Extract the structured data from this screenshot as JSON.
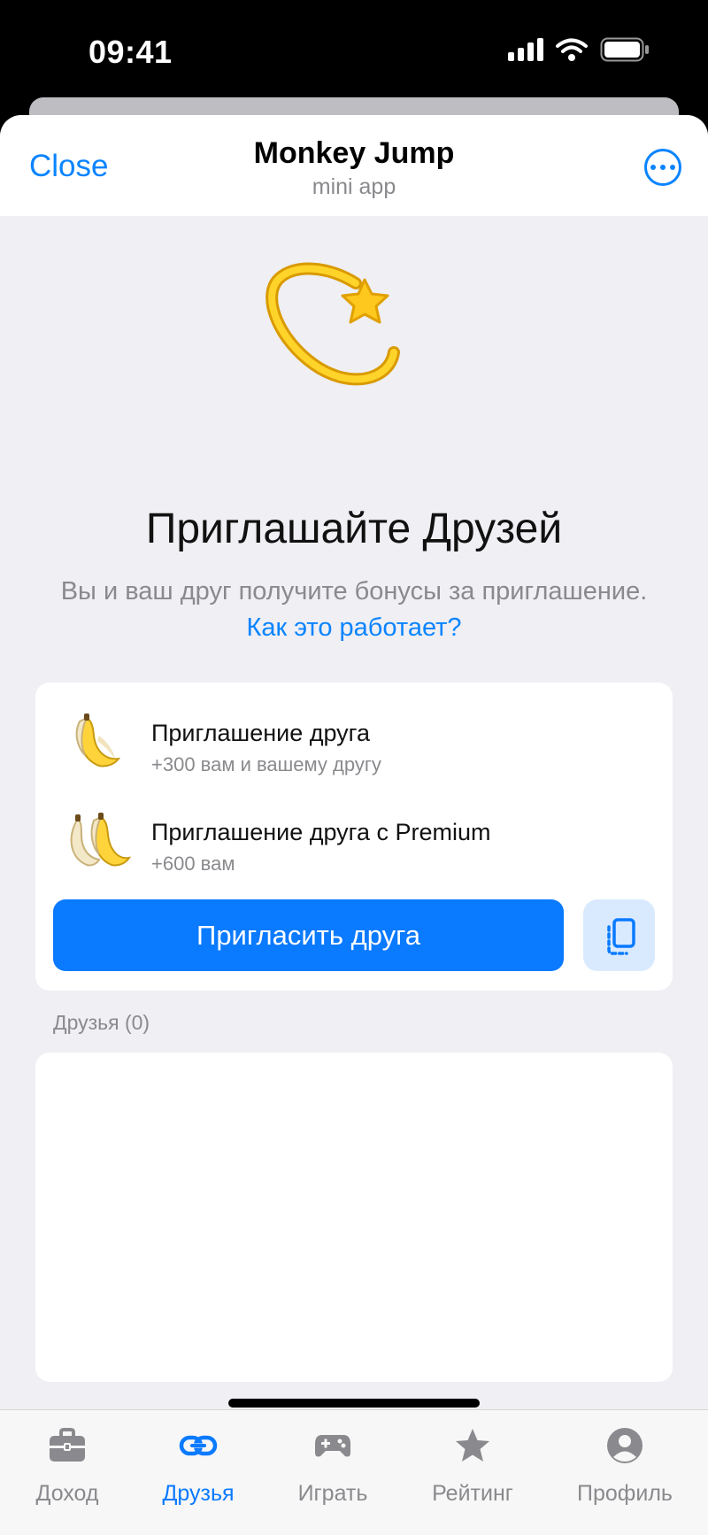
{
  "status_bar": {
    "time": "09:41"
  },
  "header": {
    "close_label": "Close",
    "title": "Monkey Jump",
    "subtitle": "mini app"
  },
  "invite": {
    "heading": "Приглашайте Друзей",
    "subtext": "Вы и ваш друг получите бонусы за приглашение.",
    "link_label": "Как это работает?"
  },
  "rewards": [
    {
      "title": "Приглашение друга",
      "subtitle": "+300 вам и вашему другу",
      "icon": "banana-icon"
    },
    {
      "title": "Приглашение друга с Premium",
      "subtitle": "+600 вам",
      "icon": "two-bananas-icon"
    }
  ],
  "invite_button_label": "Пригласить друга",
  "friends": {
    "label": "Друзья (0)",
    "items": []
  },
  "tabs": [
    {
      "label": "Доход",
      "icon": "briefcase-icon",
      "active": false
    },
    {
      "label": "Друзья",
      "icon": "link-icon",
      "active": true
    },
    {
      "label": "Играть",
      "icon": "gamepad-icon",
      "active": false
    },
    {
      "label": "Рейтинг",
      "icon": "star-icon",
      "active": false
    },
    {
      "label": "Профиль",
      "icon": "profile-icon",
      "active": false
    }
  ],
  "colors": {
    "accent": "#0a84ff",
    "button": "#0a7aff",
    "background": "#efeff4",
    "muted": "#8a8a8e"
  }
}
